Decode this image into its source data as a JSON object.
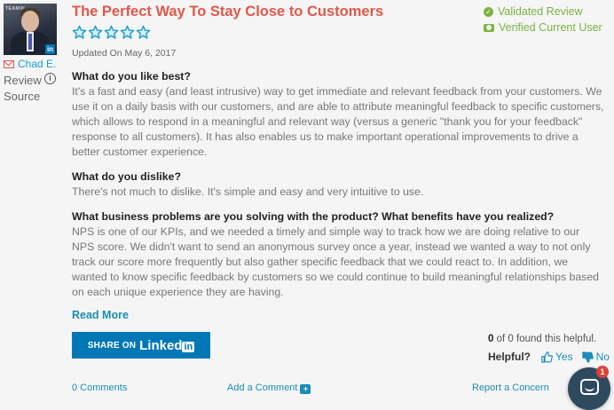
{
  "reviewer": {
    "name": "Chad E.",
    "source_label": "Review Source",
    "linkedin_badge": "in",
    "photo_banner": "TEAMIN"
  },
  "review": {
    "title": "The Perfect Way To Stay Close to Customers",
    "rating": 5,
    "rating_max": 5,
    "updated": "Updated On May 6, 2017",
    "badges": {
      "validated": "Validated Review",
      "verified": "Verified Current User"
    },
    "sections": [
      {
        "question": "What do you like best?",
        "answer": "It's a fast and easy (and least intrusive) way to get immediate and relevant feedback from your customers. We use it on a daily basis with our customers, and are able to attribute meaningful feedback to specific customers, which allows to respond in a meaningful and relevant way (versus a generic \"thank you for your feedback\" response to all customers). It has also enables us to make important operational improvements to drive a better customer experience."
      },
      {
        "question": "What do you dislike?",
        "answer": "There's not much to dislike. It's simple and easy and very intuitive to use."
      },
      {
        "question": "What business problems are you solving with the product? What benefits have you realized?",
        "answer": "NPS is one of our KPIs, and we needed a timely and simple way to track how we are doing relative to our NPS score. We didn't want to send an anonymous survey once a year, instead we wanted a way to not only track our score more frequently but also gather specific feedback that we could react to. In addition, we wanted to know specific feedback by customers so we could continue to build meaningful relationships based on each unique experience they are having."
      }
    ],
    "read_more": "Read More"
  },
  "share": {
    "label": "SHARE ON",
    "brand": "Linked",
    "brand_suffix": "in"
  },
  "helpful": {
    "count": "0",
    "of": "of",
    "total": "0",
    "suffix": "found this helpful.",
    "question": "Helpful?",
    "yes": "Yes",
    "no": "No"
  },
  "footer": {
    "comments": "0 Comments",
    "add_comment": "Add a Comment",
    "report": "Report a Concern"
  },
  "chat": {
    "notification_count": "1"
  },
  "colors": {
    "accent_red": "#e0584a",
    "link_blue": "#1a8cb8",
    "star_blue": "#1a9ccf",
    "badge_green": "#7cb342",
    "linkedin_blue": "#0077b5"
  }
}
